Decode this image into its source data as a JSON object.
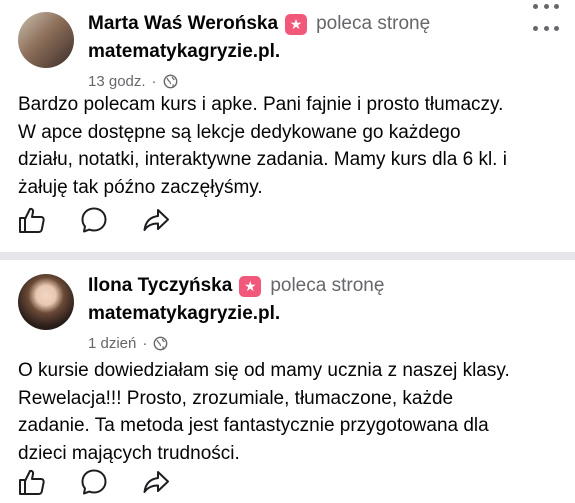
{
  "posts": [
    {
      "author": "Marta Waś Werońska",
      "verb": "poleca stronę",
      "page": "matematykagryzie.pl.",
      "time": "13 godz.",
      "dot": "·",
      "privacy_icon": "globe-icon",
      "badge_icon": "recommend-star-icon",
      "text": "Bardzo polecam kurs i apke. Pani fajnie i prosto tłumaczy. W apce dostępne są lekcje dedykowane go każdego działu, notatki, interaktywne zadania. Mamy kurs dla 6 kl. i żałuję tak późno zaczęłyśmy.",
      "text_lines": [
        "Bardzo polecam kurs i apke. Pani fajnie i prosto tłumaczy.",
        "W apce dostępne są lekcje dedykowane go każdego",
        "działu, notatki, interaktywne zadania. Mamy kurs dla 6 kl. i",
        "żałuję tak późno zaczęłyśmy."
      ],
      "actions": [
        "like-icon",
        "comment-icon",
        "share-icon"
      ]
    },
    {
      "author": "Ilona Tyczyńska",
      "verb": "poleca stronę",
      "page": "matematykagryzie.pl.",
      "time": "1 dzień",
      "dot": "·",
      "privacy_icon": "globe-icon",
      "badge_icon": "recommend-star-icon",
      "text": "O kursie dowiedziałam się od mamy ucznia z naszej klasy. Rewelacja!!! Prosto, zrozumiale, tłumaczone, każde zadanie. Ta metoda jest fantastycznie przygotowana dla dzieci mających trudności.",
      "text_lines": [
        "O kursie dowiedziałam się od mamy ucznia z naszej klasy.",
        "Rewelacja!!! Prosto, zrozumiale, tłumaczone, każde",
        "zadanie. Ta metoda jest fantastycznie przygotowana dla",
        "dzieci mających trudności."
      ],
      "actions": [
        "like-icon",
        "comment-icon",
        "share-icon"
      ]
    }
  ],
  "colors": {
    "badge": "#f1587a",
    "secondary_text": "#65676b",
    "divider": "#e4e6eb"
  }
}
